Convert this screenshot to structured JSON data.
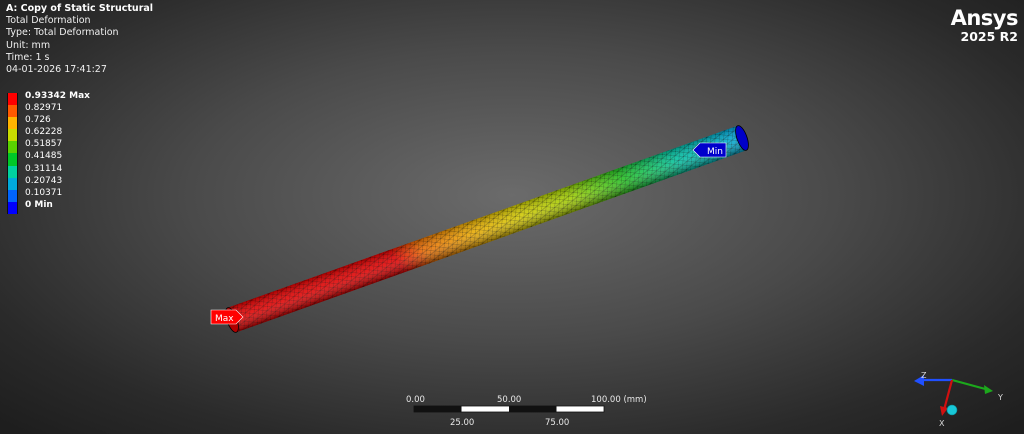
{
  "info": {
    "system": "A: Copy of Static Structural",
    "result_name": "Total Deformation",
    "type_line": "Type: Total Deformation",
    "unit_line": "Unit: mm",
    "time_line": "Time: 1 s",
    "timestamp": "04-01-2026 17:41:27"
  },
  "legend": [
    {
      "label": "0.93342 Max",
      "color": "#ff0000",
      "bold": true
    },
    {
      "label": "0.82971",
      "color": "#ff5a00",
      "bold": false
    },
    {
      "label": "0.726",
      "color": "#ffb400",
      "bold": false
    },
    {
      "label": "0.62228",
      "color": "#c8dc00",
      "bold": false
    },
    {
      "label": "0.51857",
      "color": "#5ad200",
      "bold": false
    },
    {
      "label": "0.41485",
      "color": "#00c828",
      "bold": false
    },
    {
      "label": "0.31114",
      "color": "#00d2a0",
      "bold": false
    },
    {
      "label": "0.20743",
      "color": "#00aadc",
      "bold": false
    },
    {
      "label": "0.10371",
      "color": "#0064ff",
      "bold": false
    },
    {
      "label": "0 Min",
      "color": "#0000ff",
      "bold": true
    }
  ],
  "brand": {
    "name": "Ansys",
    "version": "2025 R2"
  },
  "probes": {
    "max_label": "Max",
    "min_label": "Min",
    "max_color": "#ff0000",
    "min_color": "#0000cc"
  },
  "scale_bar": {
    "top_labels": [
      "0.00",
      "50.00",
      "100.00 (mm)"
    ],
    "bottom_labels": [
      "25.00",
      "75.00"
    ]
  },
  "triad": {
    "x_label": "X",
    "y_label": "Y",
    "z_label": "Z"
  }
}
